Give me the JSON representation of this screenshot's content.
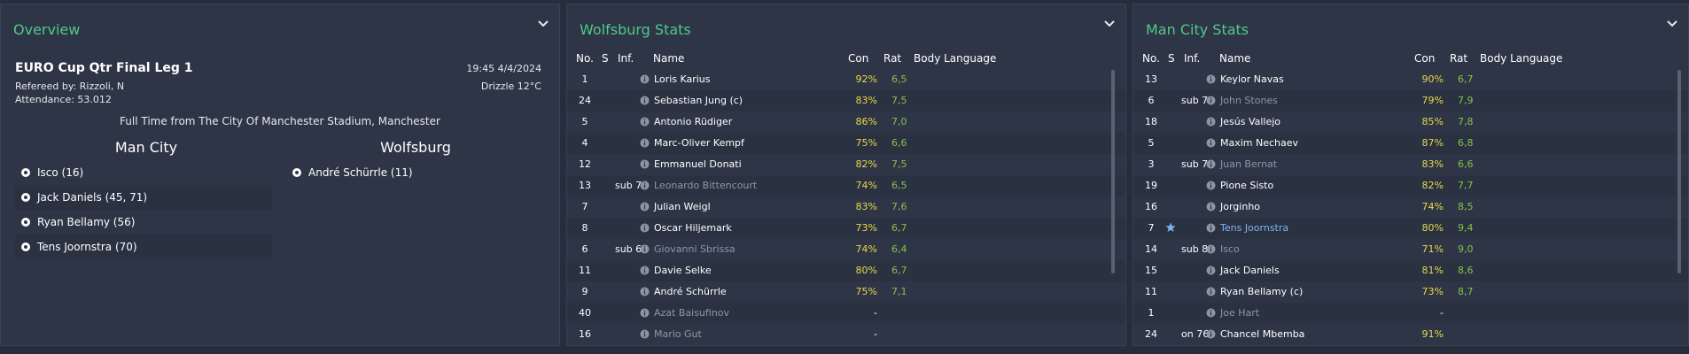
{
  "overview": {
    "title": "Overview",
    "competition": "EURO Cup Qtr Final Leg 1",
    "datetime": "19:45 4/4/2024",
    "referee": "Refereed by: Rizzoli, N",
    "weather": "Drizzle 12°C",
    "attendance": "Attendance: 53.012",
    "result_line": "Full Time from The City Of Manchester Stadium, Manchester",
    "home_team": "Man City",
    "away_team": "Wolfsburg",
    "home_scorers": [
      "Isco (16)",
      "Jack Daniels (45, 71)",
      "Ryan Bellamy (56)",
      "Tens Joornstra (70)"
    ],
    "away_scorers": [
      "André Schürrle (11)"
    ]
  },
  "columns": {
    "no": "No.",
    "s": "S",
    "inf": "Inf.",
    "name": "Name",
    "con": "Con",
    "rat": "Rat",
    "body": "Body Language"
  },
  "wolfsburg": {
    "title": "Wolfsburg Stats",
    "rows": [
      {
        "no": "1",
        "inf": "",
        "name": "Loris Karius",
        "con": "92%",
        "rat": "6,5",
        "dim": false
      },
      {
        "no": "24",
        "inf": "",
        "name": "Sebastian Jung (c)",
        "con": "83%",
        "rat": "7,5",
        "dim": false
      },
      {
        "no": "5",
        "inf": "",
        "name": "Antonio Rüdiger",
        "con": "86%",
        "rat": "7,0",
        "dim": false
      },
      {
        "no": "4",
        "inf": "",
        "name": "Marc-Oliver Kempf",
        "con": "75%",
        "rat": "6,6",
        "dim": false
      },
      {
        "no": "12",
        "inf": "",
        "name": "Emmanuel Donati",
        "con": "82%",
        "rat": "7,5",
        "dim": false
      },
      {
        "no": "13",
        "inf": "sub 70",
        "name": "Leonardo Bittencourt",
        "con": "74%",
        "rat": "6,5",
        "dim": true
      },
      {
        "no": "7",
        "inf": "",
        "name": "Julian Weigl",
        "con": "83%",
        "rat": "7,6",
        "dim": false
      },
      {
        "no": "8",
        "inf": "",
        "name": "Oscar Hiljemark",
        "con": "73%",
        "rat": "6,7",
        "dim": false
      },
      {
        "no": "6",
        "inf": "sub 67",
        "name": "Giovanni Sbrissa",
        "con": "74%",
        "rat": "6,4",
        "dim": true
      },
      {
        "no": "11",
        "inf": "",
        "name": "Davie Selke",
        "con": "80%",
        "rat": "6,7",
        "dim": false
      },
      {
        "no": "9",
        "inf": "",
        "name": "André Schürrle",
        "con": "75%",
        "rat": "7,1",
        "dim": false
      },
      {
        "no": "40",
        "inf": "",
        "name": "Azat Baisufinov",
        "con": "-",
        "rat": "",
        "dim": true
      },
      {
        "no": "16",
        "inf": "",
        "name": "Mario Gut",
        "con": "-",
        "rat": "",
        "dim": true
      }
    ]
  },
  "mancity": {
    "title": "Man City Stats",
    "rows": [
      {
        "no": "13",
        "inf": "",
        "name": "Keylor Navas",
        "con": "90%",
        "rat": "6,7",
        "dim": false
      },
      {
        "no": "6",
        "inf": "sub 76",
        "name": "John Stones",
        "con": "79%",
        "rat": "7,9",
        "dim": true
      },
      {
        "no": "18",
        "inf": "",
        "name": "Jesús Vallejo",
        "con": "85%",
        "rat": "7,8",
        "dim": false
      },
      {
        "no": "5",
        "inf": "",
        "name": "Maxim Nechaev",
        "con": "87%",
        "rat": "6,8",
        "dim": false
      },
      {
        "no": "3",
        "inf": "sub 76",
        "name": "Juan Bernat",
        "con": "83%",
        "rat": "6,6",
        "dim": true
      },
      {
        "no": "19",
        "inf": "",
        "name": "Pione Sisto",
        "con": "82%",
        "rat": "7,7",
        "dim": false
      },
      {
        "no": "16",
        "inf": "",
        "name": "Jorginho",
        "con": "74%",
        "rat": "8,5",
        "dim": false
      },
      {
        "no": "7",
        "inf": "",
        "name": "Tens Joornstra",
        "con": "80%",
        "rat": "9,4",
        "dim": false,
        "star": true
      },
      {
        "no": "14",
        "inf": "sub 84",
        "name": "Isco",
        "con": "71%",
        "rat": "9,0",
        "dim": true
      },
      {
        "no": "15",
        "inf": "",
        "name": "Jack Daniels",
        "con": "81%",
        "rat": "8,6",
        "dim": false
      },
      {
        "no": "11",
        "inf": "",
        "name": "Ryan Bellamy (c)",
        "con": "73%",
        "rat": "8,7",
        "dim": false
      },
      {
        "no": "1",
        "inf": "",
        "name": "Joe Hart",
        "con": "-",
        "rat": "",
        "dim": true
      },
      {
        "no": "24",
        "inf": "on 76",
        "name": "Chancel Mbemba",
        "con": "91%",
        "rat": "",
        "dim": false
      }
    ]
  },
  "colors": {
    "accent": "#4fc98b",
    "con": "#e8d84a",
    "rat": "#86c24a",
    "highlight": "#7fb3f0"
  },
  "icons": {
    "ball": "football-icon",
    "info": "info-icon",
    "chevron": "chevron-down-icon",
    "star": "star-icon"
  }
}
